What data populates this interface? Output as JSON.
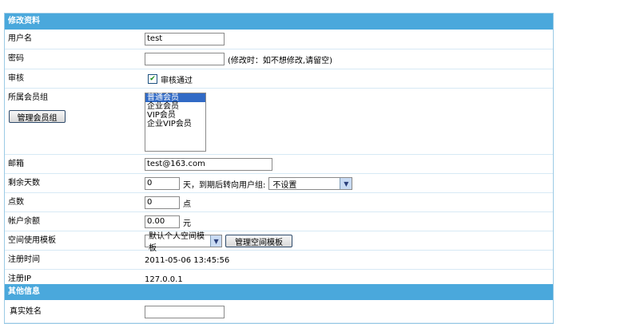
{
  "sections": {
    "edit": "修改资料",
    "other": "其他信息"
  },
  "fields": {
    "username": {
      "label": "用户名",
      "value": "test"
    },
    "password": {
      "label": "密码",
      "value": "",
      "hint": "(修改时：如不想修改,请留空)"
    },
    "audit": {
      "label": "审核",
      "checkbox_label": "审核通过",
      "checked": true
    },
    "group": {
      "label": "所属会员组",
      "manage_button": "管理会员组",
      "options": [
        "普通会员",
        "企业会员",
        "VIP会员",
        "企业VIP会员"
      ],
      "selected": "普通会员"
    },
    "email": {
      "label": "邮箱",
      "value": "test@163.com"
    },
    "days": {
      "label": "剩余天数",
      "value": "0",
      "text_after": "天，到期后转向用户组:",
      "select_value": "不设置"
    },
    "points": {
      "label": "点数",
      "value": "0",
      "unit": "点"
    },
    "balance": {
      "label": "帐户余额",
      "value": "0.00",
      "unit": "元"
    },
    "template": {
      "label": "空间使用模板",
      "select_value": "默认个人空间模板",
      "manage_button": "管理空间模板"
    },
    "reg_time": {
      "label": "注册时间",
      "value": "2011-05-06 13:45:56"
    },
    "reg_ip": {
      "label": "注册IP",
      "value": "127.0.0.1"
    },
    "real_name": {
      "label": "真实姓名",
      "value": ""
    }
  },
  "colors": {
    "section_header": "#4aa8dc",
    "row_border": "#d7e9f5",
    "panel_border": "#9ccbe6"
  }
}
